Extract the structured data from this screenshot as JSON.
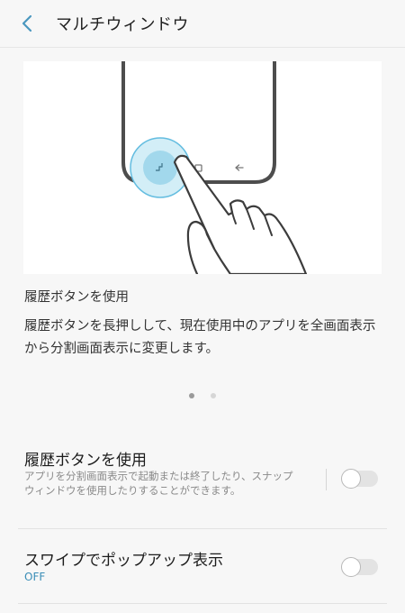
{
  "header": {
    "title": "マルチウィンドウ"
  },
  "illustration": {
    "title": "履歴ボタンを使用",
    "description": "履歴ボタンを長押しして、現在使用中のアプリを全画面表示から分割画面表示に変更します。",
    "page_count": 2,
    "active_page": 1
  },
  "settings": [
    {
      "title": "履歴ボタンを使用",
      "description": "アプリを分割画面表示で起動または終了したり、スナップウィンドウを使用したりすることができます。",
      "enabled": false
    },
    {
      "title": "スワイプでポップアップ表示",
      "status": "OFF",
      "enabled": false
    }
  ],
  "colors": {
    "accent": "#3a8db7",
    "highlight": "#7cc5e2"
  }
}
